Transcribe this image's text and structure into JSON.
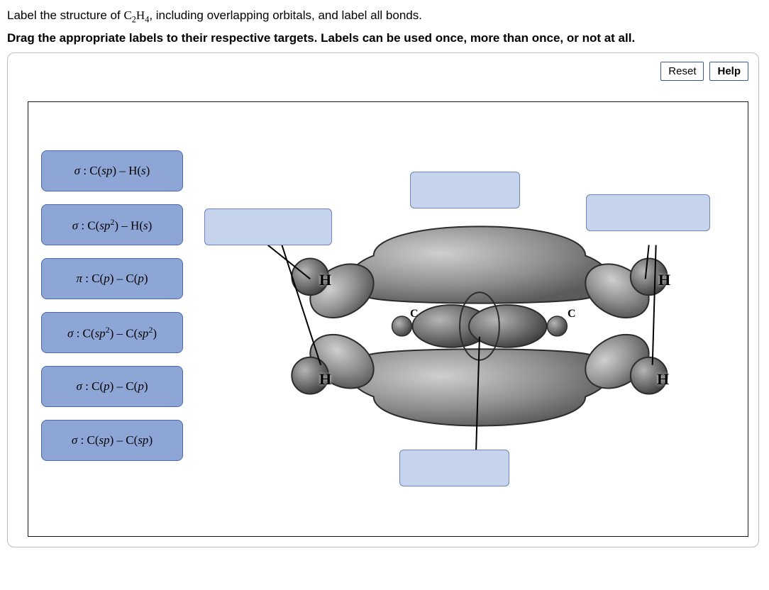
{
  "question": {
    "line1_pre": "Label the structure of ",
    "formula_base": "C",
    "formula_sub1": "2",
    "formula_mid": "H",
    "formula_sub2": "4",
    "line1_post": ", including overlapping orbitals, and label all bonds.",
    "line2": "Drag the appropriate labels to their respective targets. Labels can be used once, more than once, or not at all."
  },
  "buttons": {
    "reset": "Reset",
    "help": "Help"
  },
  "labels": {
    "l1": {
      "sigma": "σ",
      "text1": " : C(",
      "orb1": "sp",
      "text2": ") – H(",
      "orb2": "s",
      "text3": ")"
    },
    "l2": {
      "sigma": "σ",
      "text1": " : C(",
      "orb1": "sp",
      "sup1": "2",
      "text2": ") – H(",
      "orb2": "s",
      "text3": ")"
    },
    "l3": {
      "pi": "π",
      "text1": " : C(",
      "orb1": "p",
      "text2": ") – C(",
      "orb2": "p",
      "text3": ")"
    },
    "l4": {
      "sigma": "σ",
      "text1": " : C(",
      "orb1": "sp",
      "sup1": "2",
      "text2": ") – C(",
      "orb2": "sp",
      "sup2": "2",
      "text3": ")"
    },
    "l5": {
      "sigma": "σ",
      "text1": " : C(",
      "orb1": "p",
      "text2": ") – C(",
      "orb2": "p",
      "text3": ")"
    },
    "l6": {
      "sigma": "σ",
      "text1": " : C(",
      "orb1": "sp",
      "text2": ") – C(",
      "orb2": "sp",
      "text3": ")"
    }
  },
  "atoms": {
    "h_ul": "H",
    "h_ll": "H",
    "h_ur": "H",
    "h_lr": "H",
    "c_l": "C",
    "c_r": "C"
  }
}
